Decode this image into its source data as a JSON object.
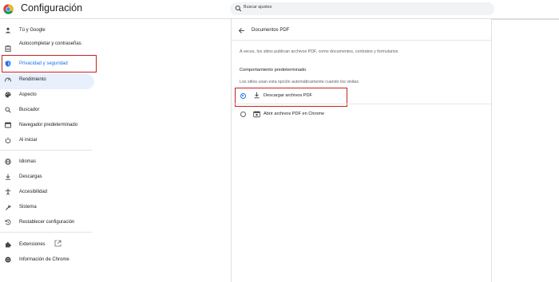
{
  "header": {
    "title": "Configuración",
    "search_placeholder": "Buscar ajustes"
  },
  "sidebar": {
    "items": [
      {
        "label": "Tú y Google",
        "icon": "person-icon"
      },
      {
        "label": "Autocompletar y contraseñas",
        "icon": "clipboard-icon"
      },
      {
        "label": "Privacidad y seguridad",
        "icon": "shield-icon",
        "active": true
      },
      {
        "label": "Rendimiento",
        "icon": "speedometer-icon"
      },
      {
        "label": "Aspecto",
        "icon": "palette-icon"
      },
      {
        "label": "Buscador",
        "icon": "search-icon"
      },
      {
        "label": "Navegador predeterminado",
        "icon": "browser-icon"
      },
      {
        "label": "Al iniciar",
        "icon": "power-icon"
      },
      {
        "label": "Idiomas",
        "icon": "globe-icon"
      },
      {
        "label": "Descargas",
        "icon": "download-icon"
      },
      {
        "label": "Accesibilidad",
        "icon": "accessibility-icon"
      },
      {
        "label": "Sistema",
        "icon": "wrench-icon"
      },
      {
        "label": "Restablecer configuración",
        "icon": "reset-icon"
      },
      {
        "label": "Extensiones",
        "icon": "puzzle-icon"
      },
      {
        "label": "Información de Chrome",
        "icon": "chrome-icon"
      }
    ]
  },
  "main": {
    "title": "Documentos PDF",
    "description": "A veces, los sitios publican archivos PDF, como documentos, contratos y formularios",
    "section_heading": "Comportamiento predeterminado",
    "section_subtitle": "Los sitios usan esta opción automáticamente cuando los visitas",
    "options": [
      {
        "label": "Descargar archivos PDF",
        "icon": "download-icon",
        "selected": true
      },
      {
        "label": "Abrir archivos PDF en Chrome",
        "icon": "pdf-viewer-icon",
        "selected": false
      }
    ]
  },
  "colors": {
    "accent": "#1a73e8",
    "active_bg": "#e8f0fe",
    "highlight": "#c5221f",
    "search_bg": "#f1f3f4"
  }
}
